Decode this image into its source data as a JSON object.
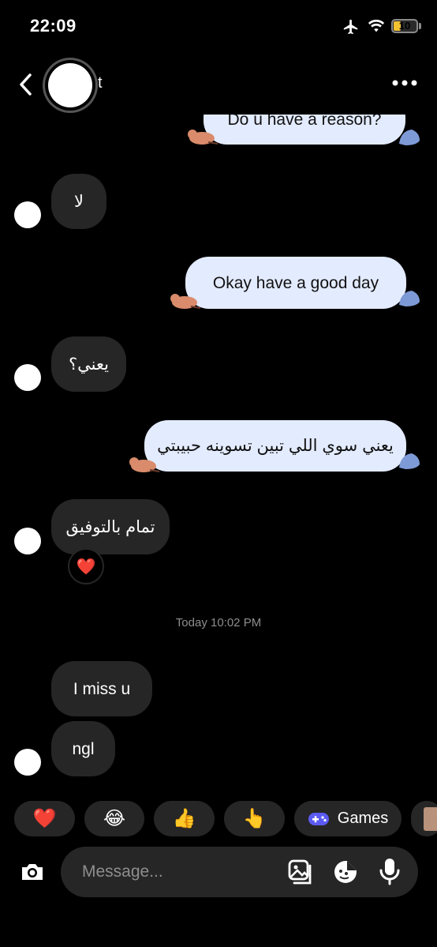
{
  "status_bar": {
    "time": "22:09",
    "battery": "10"
  },
  "header": {
    "contact_name": "t"
  },
  "messages": [
    {
      "side": "out",
      "text": "Do u have a reason?"
    },
    {
      "side": "in",
      "text": "لا"
    },
    {
      "side": "out",
      "text": "Okay have a good day"
    },
    {
      "side": "in",
      "text": "يعني؟"
    },
    {
      "side": "out",
      "text": "يعني سوي اللي تبين تسوينه حبيبتي"
    },
    {
      "side": "in",
      "text": "تمام بالتوفيق",
      "reaction": "❤️"
    },
    {
      "side": "in",
      "text": "I miss u"
    },
    {
      "side": "in",
      "text": "ngl"
    }
  ],
  "timestamp": "Today 10:02 PM",
  "quick_reactions": [
    {
      "emoji": "❤️"
    },
    {
      "emoji": "😂"
    },
    {
      "emoji": "👍"
    },
    {
      "emoji": "👆"
    },
    {
      "icon": "gamepad-icon",
      "label": "Games"
    }
  ],
  "composer": {
    "placeholder": "Message..."
  },
  "colors": {
    "incoming_bubble": "#262626",
    "outgoing_bubble": "#e3ebff",
    "games_icon": "#5b5bf2"
  }
}
